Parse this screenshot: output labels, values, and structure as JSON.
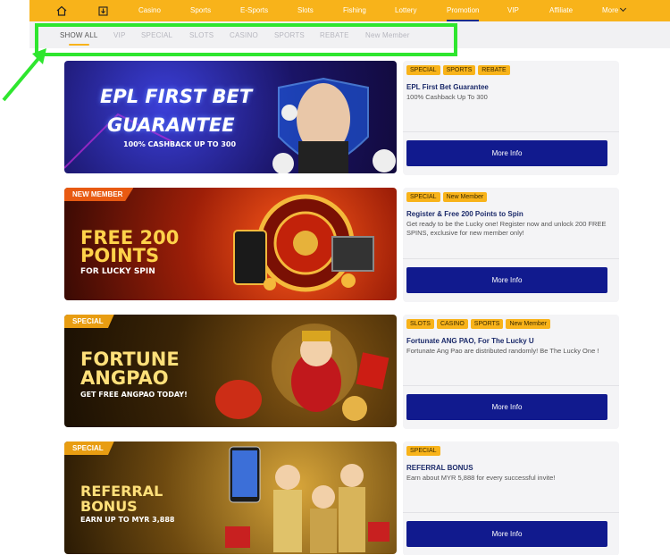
{
  "nav": {
    "items": [
      "Casino",
      "Sports",
      "E-Sports",
      "Slots",
      "Fishing",
      "Lottery",
      "Promotion",
      "VIP",
      "Affiliate",
      "More"
    ],
    "active": "Promotion",
    "icons": [
      "home-icon",
      "download-icon"
    ]
  },
  "filters": {
    "tabs": [
      "SHOW ALL",
      "VIP",
      "SPECIAL",
      "SLOTS",
      "CASINO",
      "SPORTS",
      "REBATE",
      "New Member"
    ],
    "active": "SHOW ALL"
  },
  "promos": [
    {
      "tags": [
        "SPECIAL",
        "SPORTS",
        "REBATE"
      ],
      "title": "EPL First Bet Guarantee",
      "desc": "100% Cashback Up To 300",
      "button": "More Info",
      "banner": {
        "line1": "EPL FIRST BET",
        "line2": "GUARANTEE",
        "line3": "100% CASHBACK UP TO 300",
        "ribbon": ""
      }
    },
    {
      "tags": [
        "SPECIAL",
        "New Member"
      ],
      "title": "Register & Free 200 Points to Spin",
      "desc": "Get ready to be the Lucky one! Register now and unlock 200 FREE SPINS, exclusive for new member only!",
      "button": "More Info",
      "banner": {
        "line1": "FREE 200",
        "line2": "POINTS",
        "line3": "FOR LUCKY SPIN",
        "ribbon": "NEW MEMBER"
      }
    },
    {
      "tags": [
        "SLOTS",
        "CASINO",
        "SPORTS",
        "New Member"
      ],
      "title": "Fortunate ANG PAO, For The Lucky U",
      "desc": "Fortunate Ang Pao are distributed randomly! Be The Lucky One !",
      "button": "More Info",
      "banner": {
        "line1": "FORTUNE",
        "line2": "ANGPAO",
        "line3": "GET FREE ANGPAO TODAY!",
        "ribbon": "SPECIAL"
      }
    },
    {
      "tags": [
        "SPECIAL"
      ],
      "title": "REFERRAL BONUS",
      "desc": "Earn about MYR 5,888 for every successful invite!",
      "button": "More Info",
      "banner": {
        "line1": "REFERRAL",
        "line2": "BONUS",
        "line3": "EARN UP TO MYR 3,888",
        "ribbon": "SPECIAL"
      }
    }
  ],
  "colors": {
    "nav": "#f8b31a",
    "button": "#111a8e",
    "highlight": "#2ee62e"
  }
}
